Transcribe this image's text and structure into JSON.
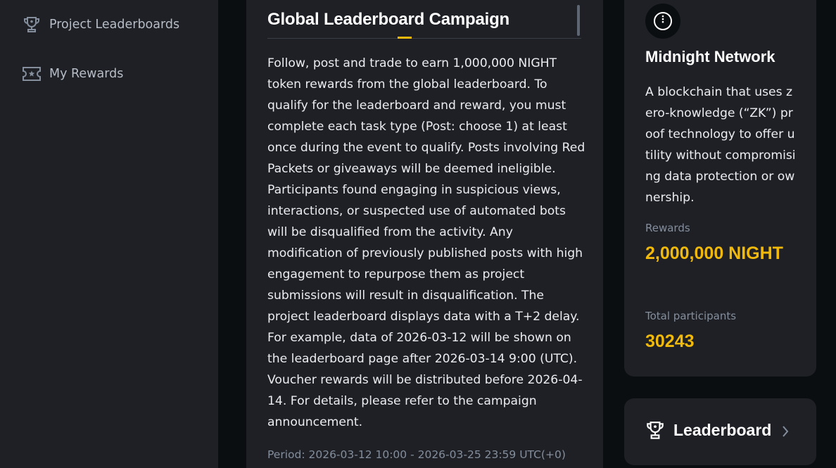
{
  "sidebar": {
    "items": [
      {
        "label": "Project Leaderboards",
        "icon": "trophy-icon"
      },
      {
        "label": "My Rewards",
        "icon": "ticket-icon"
      }
    ]
  },
  "campaign": {
    "title": "Global Leaderboard Campaign",
    "description": "Follow, post and trade to earn 1,000,000 NIGHT token rewards from the global leaderboard. To qualify for the leaderboard and reward, you must complete each task type (Post: choose 1) at least once during the event to qualify. Posts involving Red Packets or giveaways will be deemed ineligible. Participants found engaging in suspicious views, interactions, or suspected use of automated bots will be disqualified from the activity. Any modification of previously published posts with high engagement to repurpose them as project submissions will result in disqualification. The project leaderboard displays data with a T+2 delay. For example, data of 2026-03-12 will be shown on the leaderboard page after 2026-03-14 9:00 (UTC). Voucher rewards will be distributed before 2026-04-14. For details, please refer to the campaign announcement.",
    "period": "Period: 2026-03-12 10:00 - 2026-03-25 23:59 UTC(+0)"
  },
  "project": {
    "name": "Midnight Network",
    "logo_icon": "midnight-logo-icon",
    "description": "A blockchain that uses zero-knowledge (“ZK”) proof technology to offer utility without compromising data protection or ownership.",
    "rewards_label": "Rewards",
    "rewards_value": "2,000,000 NIGHT",
    "participants_label": "Total participants",
    "participants_value": "30243"
  },
  "leaderboard_link": {
    "label": "Leaderboard",
    "icon": "trophy-icon"
  },
  "colors": {
    "accent": "#f0b90b",
    "card_bg": "#1e2026",
    "page_bg": "#0b0e11"
  }
}
